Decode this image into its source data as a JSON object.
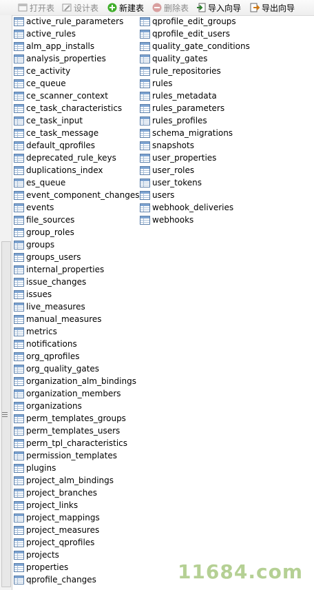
{
  "toolbar": {
    "open_label": "打开表",
    "design_label": "设计表",
    "new_label": "新建表",
    "delete_label": "删除表",
    "import_label": "导入向导",
    "export_label": "导出向导"
  },
  "tables_col1": [
    "active_rule_parameters",
    "active_rules",
    "alm_app_installs",
    "analysis_properties",
    "ce_activity",
    "ce_queue",
    "ce_scanner_context",
    "ce_task_characteristics",
    "ce_task_input",
    "ce_task_message",
    "default_qprofiles",
    "deprecated_rule_keys",
    "duplications_index",
    "es_queue",
    "event_component_changes",
    "events",
    "file_sources",
    "group_roles",
    "groups",
    "groups_users",
    "internal_properties",
    "issue_changes",
    "issues",
    "live_measures",
    "manual_measures",
    "metrics",
    "notifications",
    "org_qprofiles",
    "org_quality_gates",
    "organization_alm_bindings",
    "organization_members",
    "organizations",
    "perm_templates_groups",
    "perm_templates_users",
    "perm_tpl_characteristics",
    "permission_templates",
    "plugins",
    "project_alm_bindings",
    "project_branches",
    "project_links",
    "project_mappings",
    "project_measures",
    "project_qprofiles",
    "projects",
    "properties",
    "qprofile_changes"
  ],
  "tables_col2": [
    "qprofile_edit_groups",
    "qprofile_edit_users",
    "quality_gate_conditions",
    "quality_gates",
    "rule_repositories",
    "rules",
    "rules_metadata",
    "rules_parameters",
    "rules_profiles",
    "schema_migrations",
    "snapshots",
    "user_properties",
    "user_roles",
    "user_tokens",
    "users",
    "webhook_deliveries",
    "webhooks"
  ],
  "watermark": "11684.com"
}
